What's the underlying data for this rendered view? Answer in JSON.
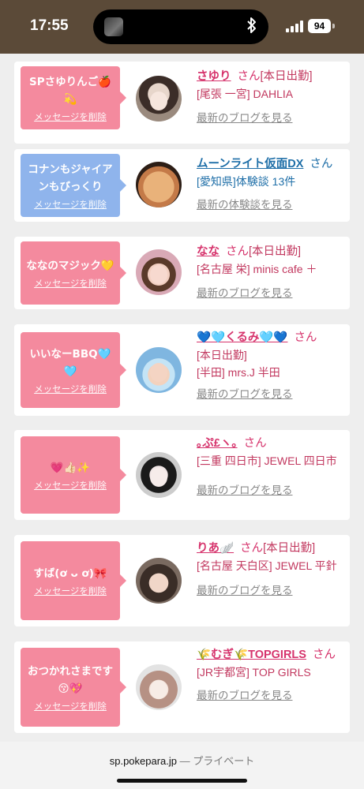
{
  "status_bar": {
    "time": "17:55",
    "battery": "94",
    "island_icon": "bluetooth-icon"
  },
  "cards": [
    {
      "message": "SPさゆりんご🍎💫",
      "delete": "メッセージを削除",
      "bubble_color": "#f48a9e",
      "name": "さゆり",
      "san": "さん",
      "status": "[本日出勤]",
      "shop": "[尾張 一宮] DAHLIA",
      "link": "最新のブログを見る",
      "blue": false
    },
    {
      "message": "コナンもジャイアンもびっくり",
      "delete": "メッセージを削除",
      "bubble_color": "#8fb4ec",
      "name": "ムーンライト仮面DX",
      "san": "さん",
      "status": "",
      "shop": "[愛知県]体験談 13件",
      "link": "最新の体験談を見る",
      "blue": true
    },
    {
      "message": "ななのマジック💛",
      "delete": "メッセージを削除",
      "bubble_color": "#f48a9e",
      "name": "なな",
      "san": "さん",
      "status": "[本日出勤]",
      "shop": "[名古屋 栄] minis cafe ＋",
      "link": "最新のブログを見る",
      "blue": false
    },
    {
      "message": "いいなーBBQ🩵🩵",
      "delete": "メッセージを削除",
      "bubble_color": "#f48a9e",
      "name": "💙🩵くるみ🩵💙",
      "san": "さん",
      "status": "[本日出勤]",
      "shop": "[半田] mrs.J 半田",
      "link": "最新のブログを見る",
      "blue": false
    },
    {
      "message": "💗👍🏻✨",
      "delete": "メッセージを削除",
      "bubble_color": "#f48a9e",
      "name": "｡ぷ£ヽ｡",
      "san": "さん",
      "status": "",
      "shop": "[三重 四日市] JEWEL 四日市",
      "link": "最新のブログを見る",
      "blue": false
    },
    {
      "message": "すば(ơ ᴗ ơ)🎀",
      "delete": "メッセージを削除",
      "bubble_color": "#f48a9e",
      "name": "りあ🪽",
      "san": "さん",
      "status": "[本日出勤]",
      "shop": "[名古屋 天白区] JEWEL 平針",
      "link": "最新のブログを見る",
      "blue": false
    },
    {
      "message": "おつかれさまです😚💖",
      "delete": "メッセージを削除",
      "bubble_color": "#f48a9e",
      "name": "🌾むぎ🌾TOPGIRLS",
      "san": "さん",
      "status": "",
      "shop": "[JR宇都宮] TOP GIRLS",
      "link": "最新のブログを見る",
      "blue": false
    }
  ],
  "bottom_bar": {
    "url": "sp.pokepara.jp",
    "separator": " — ",
    "mode": "プライベート"
  }
}
